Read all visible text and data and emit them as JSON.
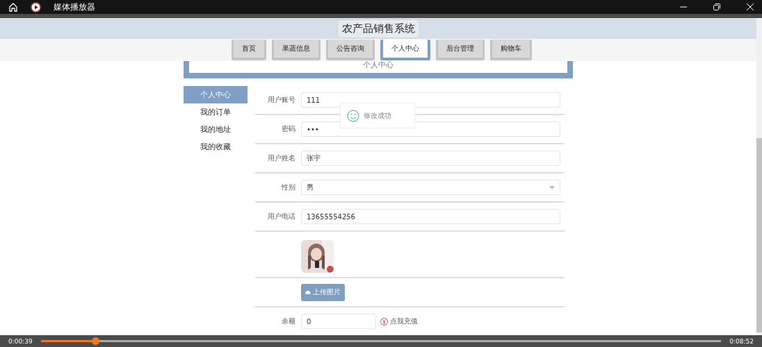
{
  "player": {
    "title": "媒体播放器",
    "current_time": "0:00:39",
    "total_time": "0:08:52",
    "level": 0.08
  },
  "site": {
    "title": "农产品销售系统",
    "banner": "个人中心",
    "nav": [
      {
        "label": "首页",
        "selected": false
      },
      {
        "label": "果蔬信息",
        "selected": false
      },
      {
        "label": "公告咨询",
        "selected": false
      },
      {
        "label": "个人中心",
        "selected": true
      },
      {
        "label": "后台管理",
        "selected": false
      },
      {
        "label": "购物车",
        "selected": false
      }
    ]
  },
  "sidebar": [
    {
      "label": "个人中心",
      "selected": true
    },
    {
      "label": "我的订单",
      "selected": false
    },
    {
      "label": "我的地址",
      "selected": false
    },
    {
      "label": "我的收藏",
      "selected": false
    }
  ],
  "form": {
    "fields": [
      {
        "kind": "text",
        "label": "用户账号",
        "value": "111"
      },
      {
        "kind": "text",
        "label": "密码",
        "value": "•••"
      },
      {
        "kind": "text",
        "label": "用户姓名",
        "value": "张宇"
      },
      {
        "kind": "select",
        "label": "性别",
        "value": "男"
      },
      {
        "kind": "text",
        "label": "用户电话",
        "value": "13655554256"
      },
      {
        "kind": "avatar"
      },
      {
        "kind": "upload",
        "button": "上传图片",
        "disabled": true
      },
      {
        "kind": "balance",
        "label": "余额",
        "value": "0",
        "action": "点我充值"
      }
    ]
  },
  "toast": {
    "message": "修改成功"
  }
}
